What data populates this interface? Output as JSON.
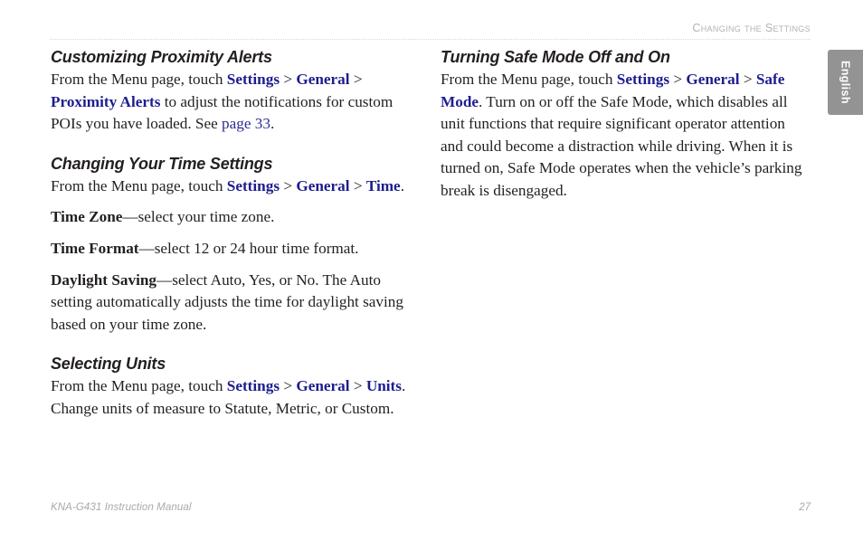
{
  "header": {
    "running_title": "Changing the Settings"
  },
  "language_tab": {
    "label": "English"
  },
  "colors": {
    "link_blue": "#1d1d8f",
    "header_gray": "#b3b3b3",
    "tab_gray": "#939393",
    "body_black": "#231f20",
    "footer_gray": "#a9a9a9"
  },
  "left_column": {
    "sections": [
      {
        "heading": "Customizing Proximity Alerts",
        "paragraphs": [
          {
            "runs": [
              {
                "text": "From the Menu page, touch ",
                "style": "normal"
              },
              {
                "text": "Settings",
                "style": "link"
              },
              {
                "text": " > ",
                "style": "sep"
              },
              {
                "text": "General",
                "style": "link"
              },
              {
                "text": " > ",
                "style": "sep"
              },
              {
                "text": "Proximity Alerts",
                "style": "link"
              },
              {
                "text": " to adjust the notifications for custom POIs you have loaded. See ",
                "style": "normal"
              },
              {
                "text": "page 33",
                "style": "link-plain"
              },
              {
                "text": ".",
                "style": "normal"
              }
            ]
          }
        ]
      },
      {
        "heading": "Changing Your Time Settings",
        "paragraphs": [
          {
            "runs": [
              {
                "text": "From the Menu page, touch ",
                "style": "normal"
              },
              {
                "text": "Settings",
                "style": "link"
              },
              {
                "text": " > ",
                "style": "sep"
              },
              {
                "text": "General",
                "style": "link"
              },
              {
                "text": " > ",
                "style": "sep"
              },
              {
                "text": "Time",
                "style": "link"
              },
              {
                "text": ".",
                "style": "normal"
              }
            ]
          },
          {
            "runs": [
              {
                "text": "Time Zone",
                "style": "term"
              },
              {
                "text": "—select your time zone.",
                "style": "normal"
              }
            ]
          },
          {
            "runs": [
              {
                "text": "Time Format",
                "style": "term"
              },
              {
                "text": "—select 12 or 24 hour time format.",
                "style": "normal"
              }
            ]
          },
          {
            "runs": [
              {
                "text": "Daylight Saving",
                "style": "term"
              },
              {
                "text": "—select Auto, Yes, or No. The Auto setting automatically adjusts the time for daylight saving based on your time zone.",
                "style": "normal"
              }
            ]
          }
        ]
      },
      {
        "heading": "Selecting Units",
        "paragraphs": [
          {
            "runs": [
              {
                "text": "From the Menu page, touch ",
                "style": "normal"
              },
              {
                "text": "Settings",
                "style": "link"
              },
              {
                "text": " > ",
                "style": "sep"
              },
              {
                "text": "General",
                "style": "link"
              },
              {
                "text": " > ",
                "style": "sep"
              },
              {
                "text": "Units",
                "style": "link"
              },
              {
                "text": ". Change units of measure to Statute, Metric, or Custom.",
                "style": "normal"
              }
            ]
          }
        ]
      }
    ]
  },
  "right_column": {
    "sections": [
      {
        "heading": "Turning Safe Mode Off and On",
        "paragraphs": [
          {
            "runs": [
              {
                "text": "From the Menu page, touch ",
                "style": "normal"
              },
              {
                "text": "Settings",
                "style": "link"
              },
              {
                "text": " > ",
                "style": "sep"
              },
              {
                "text": "General",
                "style": "link"
              },
              {
                "text": " > ",
                "style": "sep"
              },
              {
                "text": "Safe Mode",
                "style": "link"
              },
              {
                "text": ". Turn on or off the Safe Mode, which disables all unit functions that require significant operator attention and could become a distraction while driving. When it is turned on, Safe Mode operates when the vehicle’s parking break is disengaged.",
                "style": "normal"
              }
            ]
          }
        ]
      }
    ]
  },
  "footer": {
    "document_title": "KNA-G431 Instruction Manual",
    "page_number": "27"
  }
}
